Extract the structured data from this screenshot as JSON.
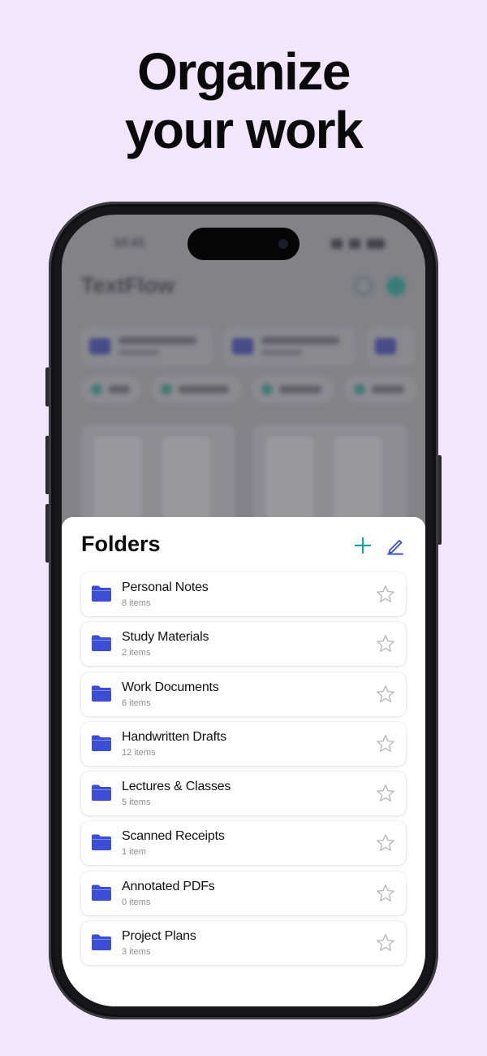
{
  "headline": {
    "line1": "Organize",
    "line2": "your work"
  },
  "background_app": {
    "time": "10:41",
    "title": "TextFlow"
  },
  "sheet": {
    "title": "Folders",
    "add_icon": "plus-icon",
    "edit_icon": "pencil-icon",
    "accent_add": "#16a39a",
    "accent_edit": "#3f4fd9",
    "folders": [
      {
        "name": "Personal Notes",
        "count": "8 items"
      },
      {
        "name": "Study Materials",
        "count": "2 items"
      },
      {
        "name": "Work Documents",
        "count": "6 items"
      },
      {
        "name": "Handwritten Drafts",
        "count": "12 items"
      },
      {
        "name": "Lectures & Classes",
        "count": "5 items"
      },
      {
        "name": "Scanned Receipts",
        "count": "1 item"
      },
      {
        "name": "Annotated PDFs",
        "count": "0 items"
      },
      {
        "name": "Project Plans",
        "count": "3 items"
      }
    ],
    "folder_icon": "folder-icon",
    "folder_color": "#3d4ed6",
    "star_icon": "star-outline-icon"
  },
  "colors": {
    "page_bg": "#f1e6fd",
    "phone_frame": "#17171a"
  }
}
